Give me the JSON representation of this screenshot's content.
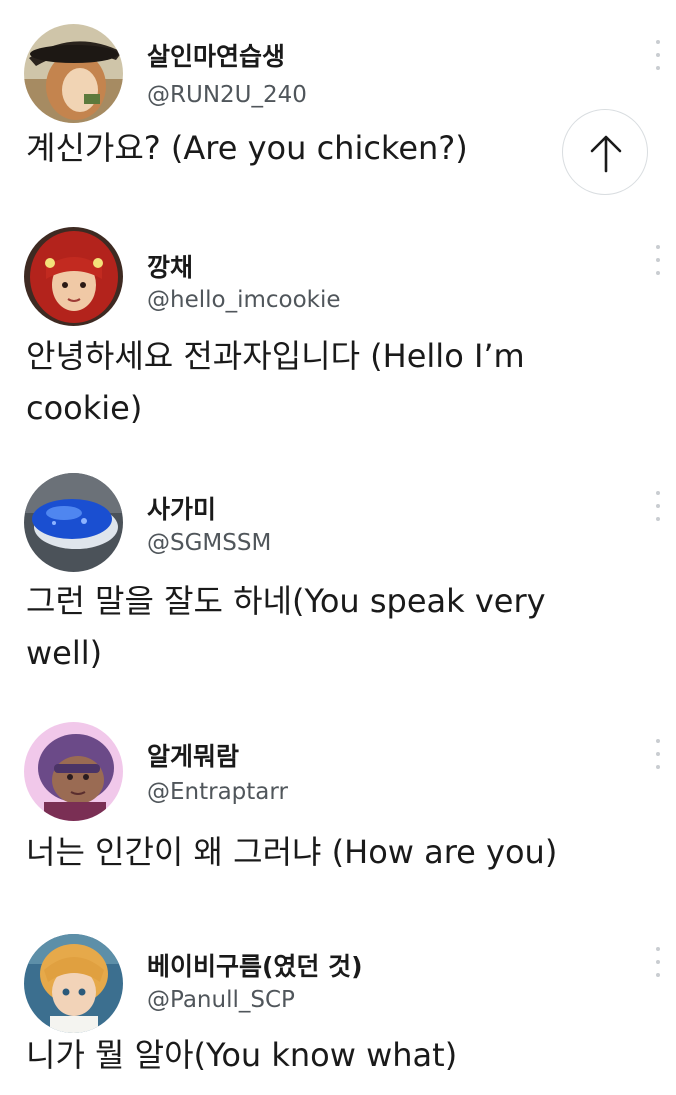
{
  "posts": [
    {
      "display_name": "살인마연습생",
      "handle": "@RUN2U_240",
      "text": "계신가요? (Are you chicken?)",
      "avatar_icon": "anime-girl-with-hat-avatar"
    },
    {
      "display_name": "깡채",
      "handle": "@hello_imcookie",
      "text": "안녕하세요 전과자입니다 (Hello I’m cookie)",
      "avatar_icon": "red-haired-girl-avatar"
    },
    {
      "display_name": "사가미",
      "handle": "@SGMSSM",
      "text": "그런 말을 잘도 하네(You speak very well)",
      "avatar_icon": "blue-sushi-avatar"
    },
    {
      "display_name": "알게뭐람",
      "handle": "@Entraptarr",
      "text": "너는 인간이 왜 그러냐 (How are you)",
      "avatar_icon": "purple-haired-cartoon-avatar"
    },
    {
      "display_name": "베이비구름(였던 것)",
      "handle": "@Panull_SCP",
      "text": "니가 뭘 알아(You know what)",
      "avatar_icon": "anime-boy-avatar"
    }
  ],
  "scroll_top": {
    "icon": "arrow-up-icon"
  },
  "colors": {
    "text": "#1a1a1a",
    "handle": "#50565b",
    "more_dots": "#c9cdd1",
    "button_border": "#d9dde0"
  }
}
